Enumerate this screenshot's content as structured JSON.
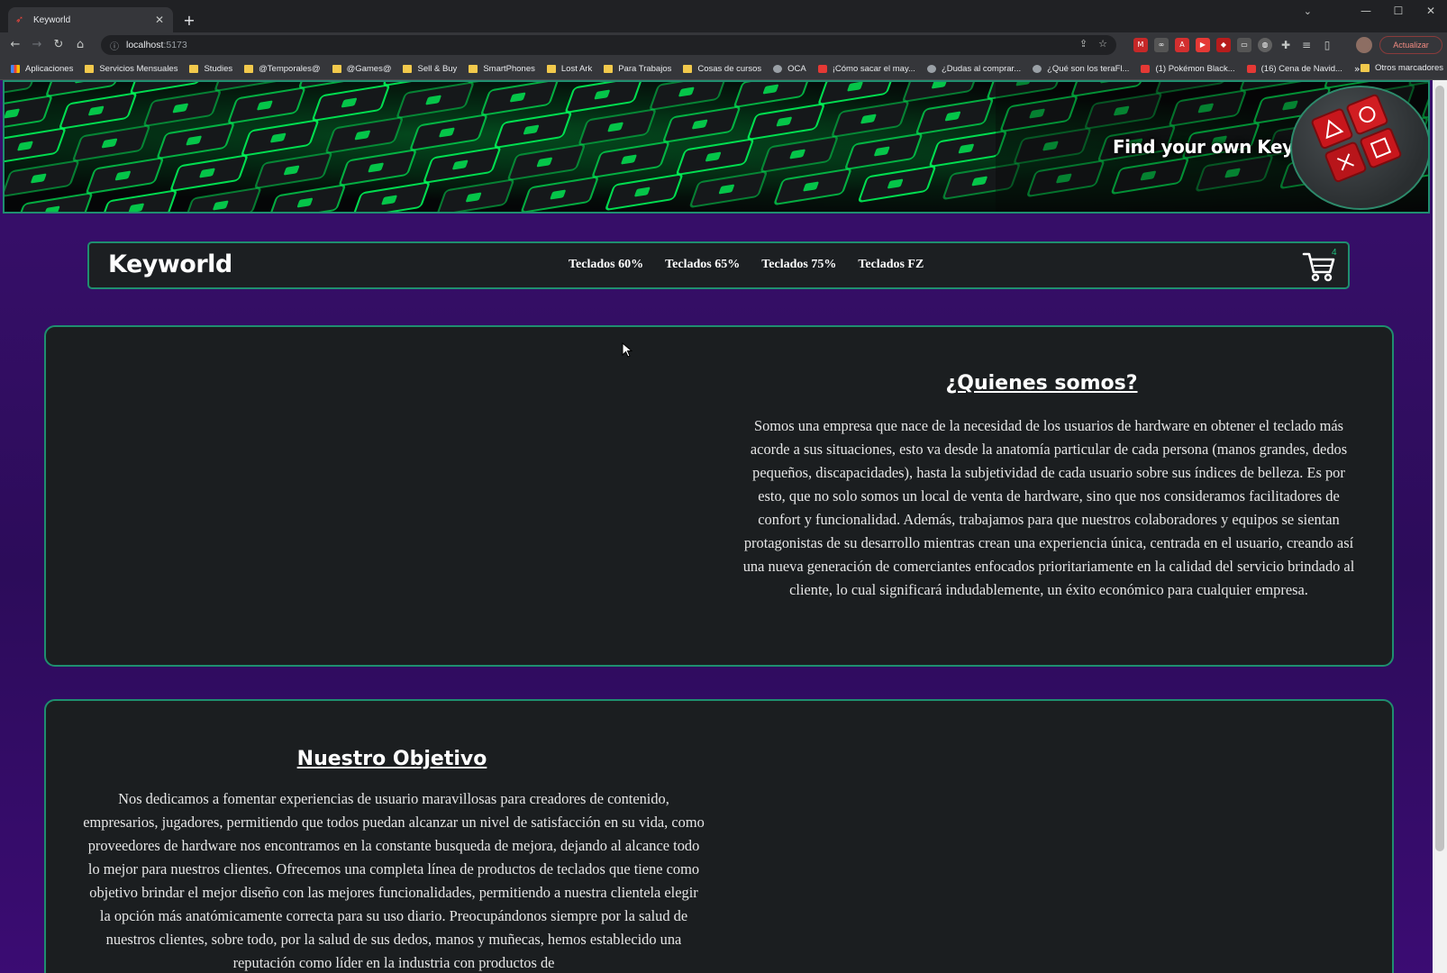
{
  "browser": {
    "tab_title": "Keyworld",
    "url_host": "localhost",
    "url_port": ":5173",
    "update_label": "Actualizar",
    "bookmarks": [
      {
        "label": "Aplicaciones",
        "icon": "apps-grid-icon"
      },
      {
        "label": "Servicios Mensuales",
        "icon": "folder-icon"
      },
      {
        "label": "Studies",
        "icon": "folder-icon"
      },
      {
        "label": "@Temporales@",
        "icon": "folder-icon"
      },
      {
        "label": "@Games@",
        "icon": "folder-icon"
      },
      {
        "label": "Sell & Buy",
        "icon": "folder-icon"
      },
      {
        "label": "SmartPhones",
        "icon": "folder-icon"
      },
      {
        "label": "Lost Ark",
        "icon": "folder-icon"
      },
      {
        "label": "Para Trabajos",
        "icon": "folder-icon"
      },
      {
        "label": "Cosas de cursos",
        "icon": "folder-icon"
      },
      {
        "label": "OCA",
        "icon": "globe-icon"
      },
      {
        "label": "¡Cómo sacar el may...",
        "icon": "youtube-icon"
      },
      {
        "label": "¿Dudas al comprar...",
        "icon": "globe-icon"
      },
      {
        "label": "¿Qué son los teraFl...",
        "icon": "globe-icon"
      },
      {
        "label": "(1) Pokémon Black...",
        "icon": "youtube-icon"
      },
      {
        "label": "(16) Cena de Navid...",
        "icon": "youtube-icon"
      }
    ],
    "bookmarks_more": "»",
    "other_bookmarks": "Otros marcadores"
  },
  "banner": {
    "tagline": "Find your own Key!"
  },
  "navbar": {
    "brand": "Keyworld",
    "links": [
      "Teclados 60%",
      "Teclados 65%",
      "Teclados 75%",
      "Teclados FZ"
    ],
    "cart_count": "4"
  },
  "about": {
    "title": "¿Quienes somos?",
    "body": "Somos una empresa que nace de la necesidad de los usuarios de hardware en obtener el teclado más acorde a sus situaciones, esto va desde la anatomía particular de cada persona (manos grandes, dedos pequeños, discapacidades), hasta la subjetividad de cada usuario sobre sus índices de belleza. Es por esto, que no solo somos un local de venta de hardware, sino que nos consideramos facilitadores de confort y funcionalidad. Además, trabajamos para que nuestros colaboradores y equipos se sientan protagonistas de su desarrollo mientras crean una experiencia única, centrada en el usuario, creando así una nueva generación de comerciantes enfocados prioritariamente en la calidad del servicio brindado al cliente, lo cual significará indudablemente, un éxito económico para cualquier empresa."
  },
  "objective": {
    "title": "Nuestro Objetivo",
    "body": "Nos dedicamos a fomentar experiencias de usuario maravillosas para creadores de contenido, empresarios, jugadores, permitiendo que todos puedan alcanzar un nivel de satisfacción en su vida, como proveedores de hardware nos encontramos en la constante busqueda de mejora, dejando al alcance todo lo mejor para nuestros clientes. Ofrecemos una completa línea de productos de teclados que tiene como objetivo brindar el mejor diseño con las mejores funcionalidades, permitiendo a nuestra clientela elegir la opción más anatómicamente correcta para su uso diario. Preocupándonos siempre por la salud de nuestros clientes, sobre todo, por la salud de sus dedos, manos y muñecas, hemos establecido una reputación como líder en la industria con productos de"
  },
  "colors": {
    "accent_border": "#1f8f6f",
    "page_background": "#2c0c5a",
    "card_background": "#1b1e20",
    "key_glow": "#00ff5a"
  }
}
